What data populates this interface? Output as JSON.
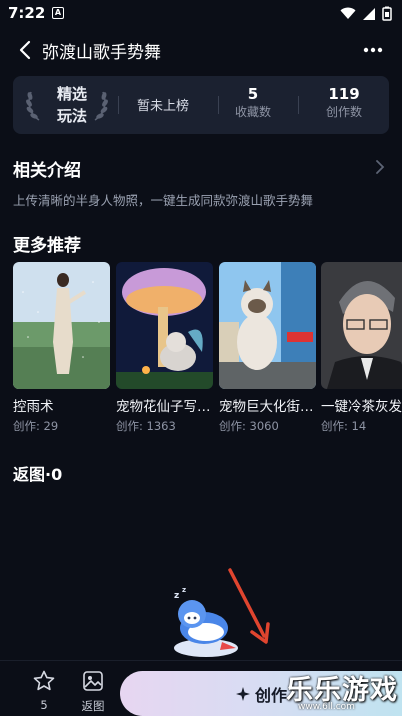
{
  "status_bar": {
    "time": "7:22",
    "notification_glyph": "A"
  },
  "header": {
    "title": "弥渡山歌手势舞"
  },
  "stats": {
    "featured_line1": "精选",
    "featured_line2": "玩法",
    "rank_text": "暂未上榜",
    "favorites_value": "5",
    "favorites_label": "收藏数",
    "works_value": "119",
    "works_label": "创作数"
  },
  "intro": {
    "title": "相关介绍",
    "description": "上传清晰的半身人物照，一键生成同款弥渡山歌手势舞"
  },
  "recommendations": {
    "title": "更多推荐",
    "items": [
      {
        "title": "控雨术",
        "count": "创作: 29"
      },
      {
        "title": "宠物花仙子写…",
        "count": "创作: 1363"
      },
      {
        "title": "宠物巨大化街…",
        "count": "创作: 3060"
      },
      {
        "title": "一键冷茶灰发",
        "count": "创作: 14"
      }
    ]
  },
  "returns": {
    "title": "返图·0"
  },
  "bottom_bar": {
    "favorite_count": "5",
    "returns_label": "返图",
    "create_label": "创作"
  },
  "watermark": {
    "main": "乐乐游戏",
    "sub": "www.6ll.com"
  },
  "colors": {
    "background": "#0b0e17",
    "card": "#1b2130",
    "accent_gradient_start": "#e7d6f1",
    "accent_gradient_end": "#bfe3f0",
    "annotation_arrow": "#e0452f"
  },
  "icons": [
    "back-arrow-icon",
    "more-icon",
    "laurel-icon",
    "chevron-right-icon",
    "star-icon",
    "image-icon",
    "sparkle-icon",
    "wifi-icon",
    "signal-icon",
    "battery-icon"
  ]
}
